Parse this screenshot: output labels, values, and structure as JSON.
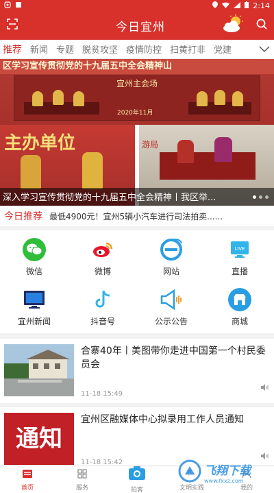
{
  "status_bar": {
    "time": "2:14"
  },
  "header": {
    "title": "今日宜州"
  },
  "tabs": [
    "推荐",
    "新闻",
    "专题",
    "脱贫攻坚",
    "疫情防控",
    "扫黄打非",
    "党建"
  ],
  "banner": {
    "top_text": "区学习宣传贯彻党的十九届五中全会精神山",
    "stage_text": "宜州主会场",
    "date_text": "2020年11月",
    "left_img_text": "主办单位",
    "right_img_text": "游局",
    "caption": "深入学习宣传贯彻党的十九届五中全会精神丨我区举..."
  },
  "recommend": {
    "label": "今日推荐",
    "text": "最低4900元！宜州5辆小汽车进行司法拍卖......"
  },
  "grid": [
    {
      "label": "微信",
      "icon": "wechat-icon",
      "color": "#2fbd3a"
    },
    {
      "label": "微博",
      "icon": "weibo-icon",
      "color": "#ffffff"
    },
    {
      "label": "网站",
      "icon": "browser-icon",
      "color": "#ffffff"
    },
    {
      "label": "直播",
      "icon": "live-icon",
      "color": "#ffffff"
    },
    {
      "label": "宜州新闻",
      "icon": "tv-icon",
      "color": "#ffffff"
    },
    {
      "label": "抖音号",
      "icon": "tiktok-icon",
      "color": "#ffffff"
    },
    {
      "label": "公示公告",
      "icon": "megaphone-icon",
      "color": "#ffffff"
    },
    {
      "label": "商城",
      "icon": "shop-icon",
      "color": "#2a9ee3"
    }
  ],
  "news": [
    {
      "title": "合寨40年丨美图带你走进中国第一个村民委员会",
      "time": "11-18 15:49"
    },
    {
      "title": "宜州区融媒体中心拟录用工作人员通知",
      "time": "11-18 15:42",
      "thumb_text": "通知"
    }
  ],
  "bottom_nav": [
    "首页",
    "服务",
    "拍客",
    "文明实践",
    "我的"
  ],
  "watermark": {
    "text": "飞翔下载",
    "sub": "www.fxxz.com"
  }
}
